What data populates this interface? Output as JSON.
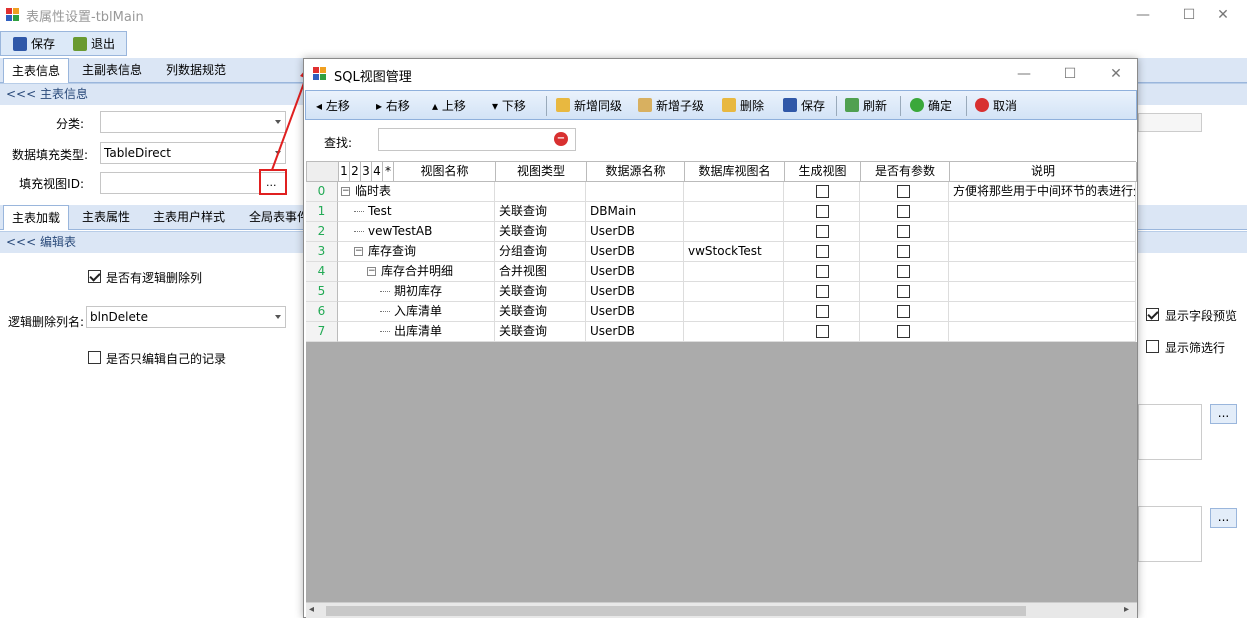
{
  "window": {
    "title": "表属性设置-tblMain",
    "minimize": "—",
    "maximize": "☐",
    "close": "✕"
  },
  "toolbar": {
    "save": "保存",
    "exit": "退出"
  },
  "tabs_top": [
    "主表信息",
    "主副表信息",
    "列数据规范"
  ],
  "section1": "<<< 主表信息",
  "form": {
    "category_label": "分类:",
    "fill_type_label": "数据填充类型:",
    "fill_type_value": "TableDirect",
    "view_id_label": "填充视图ID:",
    "ellipsis": "..."
  },
  "tabs_mid": [
    "主表加载",
    "主表属性",
    "主表用户样式",
    "全局表事件"
  ],
  "section2": "<<< 编辑表",
  "edit": {
    "logic_delete_col": "是否有逻辑删除列",
    "logic_delete_label": "逻辑删除列名:",
    "logic_delete_value": "blnDelete",
    "only_own": "是否只编辑自己的记录"
  },
  "right": {
    "show_preview": "显示字段预览",
    "show_filter": "显示筛选行",
    "ellipsis": "..."
  },
  "dialog": {
    "title": "SQL视图管理",
    "minimize": "—",
    "maximize": "☐",
    "close": "✕",
    "buttons": [
      "左移",
      "右移",
      "上移",
      "下移",
      "新增同级",
      "新增子级",
      "删除",
      "保存",
      "刷新",
      "确定",
      "取消"
    ],
    "search_label": "查找:",
    "level_headers": [
      "1",
      "2",
      "3",
      "4",
      "*"
    ],
    "columns": [
      "视图名称",
      "视图类型",
      "数据源名称",
      "数据库视图名",
      "生成视图",
      "是否有参数",
      "说明"
    ],
    "rows": [
      {
        "idx": "0",
        "name": "临时表",
        "type": "",
        "ds": "",
        "dbview": "",
        "note": "方便将那些用于中间环节的表进行分"
      },
      {
        "idx": "1",
        "name": "Test",
        "type": "关联查询",
        "ds": "DBMain",
        "dbview": "",
        "note": ""
      },
      {
        "idx": "2",
        "name": "vewTestAB",
        "type": "关联查询",
        "ds": "UserDB",
        "dbview": "",
        "note": ""
      },
      {
        "idx": "3",
        "name": "库存查询",
        "type": "分组查询",
        "ds": "UserDB",
        "dbview": "vwStockTest",
        "note": ""
      },
      {
        "idx": "4",
        "name": "库存合并明细",
        "type": "合并视图",
        "ds": "UserDB",
        "dbview": "",
        "note": ""
      },
      {
        "idx": "5",
        "name": "期初库存",
        "type": "关联查询",
        "ds": "UserDB",
        "dbview": "",
        "note": ""
      },
      {
        "idx": "6",
        "name": "入库清单",
        "type": "关联查询",
        "ds": "UserDB",
        "dbview": "",
        "note": ""
      },
      {
        "idx": "7",
        "name": "出库清单",
        "type": "关联查询",
        "ds": "UserDB",
        "dbview": "",
        "note": ""
      }
    ]
  },
  "colors": {
    "accent": "#dbe6f5",
    "highlight": "#e02020"
  }
}
